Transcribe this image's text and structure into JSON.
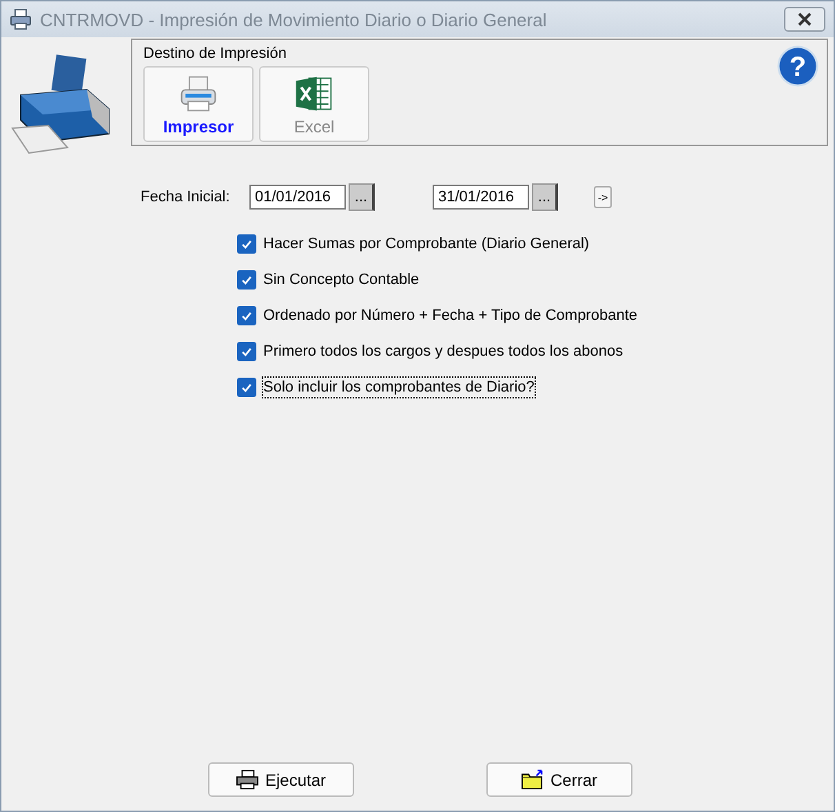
{
  "window": {
    "title": "CNTRMOVD - Impresión de Movimiento Diario o Diario General"
  },
  "destination": {
    "title": "Destino de Impresión",
    "options": [
      {
        "label": "Impresor",
        "kind": "printer",
        "selected": true
      },
      {
        "label": "Excel",
        "kind": "excel",
        "selected": false
      }
    ],
    "help": "?"
  },
  "dates": {
    "label": "Fecha Inicial:",
    "start": "01/01/2016",
    "end": "31/01/2016",
    "picker": "...",
    "next": "->"
  },
  "options": [
    {
      "label": "Hacer Sumas por Comprobante (Diario General)",
      "checked": true,
      "focused": false
    },
    {
      "label": "Sin Concepto Contable",
      "checked": true,
      "focused": false
    },
    {
      "label": "Ordenado por Número + Fecha + Tipo de Comprobante",
      "checked": true,
      "focused": false
    },
    {
      "label": "Primero todos los cargos y despues todos los abonos",
      "checked": true,
      "focused": false
    },
    {
      "label": "Solo incluir los comprobantes de Diario?",
      "checked": true,
      "focused": true
    }
  ],
  "buttons": [
    {
      "label": "Ejecutar",
      "kind": "run"
    },
    {
      "label": "Cerrar",
      "kind": "close"
    }
  ]
}
